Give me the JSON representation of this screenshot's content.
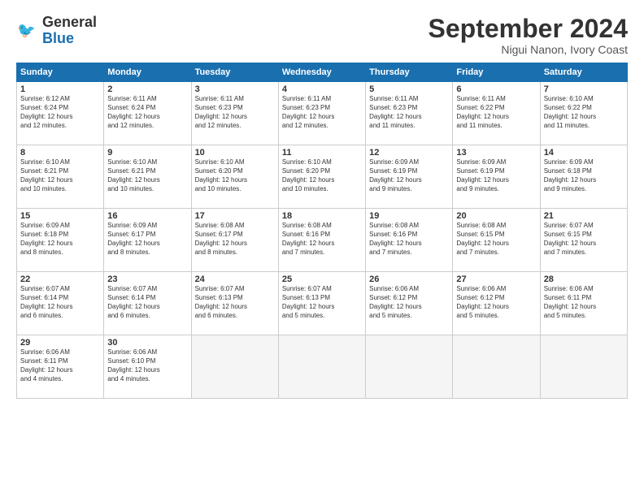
{
  "logo": {
    "line1": "General",
    "line2": "Blue"
  },
  "title": "September 2024",
  "subtitle": "Nigui Nanon, Ivory Coast",
  "weekdays": [
    "Sunday",
    "Monday",
    "Tuesday",
    "Wednesday",
    "Thursday",
    "Friday",
    "Saturday"
  ],
  "weeks": [
    [
      {
        "day": "1",
        "info": "Sunrise: 6:12 AM\nSunset: 6:24 PM\nDaylight: 12 hours\nand 12 minutes."
      },
      {
        "day": "2",
        "info": "Sunrise: 6:11 AM\nSunset: 6:24 PM\nDaylight: 12 hours\nand 12 minutes."
      },
      {
        "day": "3",
        "info": "Sunrise: 6:11 AM\nSunset: 6:23 PM\nDaylight: 12 hours\nand 12 minutes."
      },
      {
        "day": "4",
        "info": "Sunrise: 6:11 AM\nSunset: 6:23 PM\nDaylight: 12 hours\nand 12 minutes."
      },
      {
        "day": "5",
        "info": "Sunrise: 6:11 AM\nSunset: 6:23 PM\nDaylight: 12 hours\nand 11 minutes."
      },
      {
        "day": "6",
        "info": "Sunrise: 6:11 AM\nSunset: 6:22 PM\nDaylight: 12 hours\nand 11 minutes."
      },
      {
        "day": "7",
        "info": "Sunrise: 6:10 AM\nSunset: 6:22 PM\nDaylight: 12 hours\nand 11 minutes."
      }
    ],
    [
      {
        "day": "8",
        "info": "Sunrise: 6:10 AM\nSunset: 6:21 PM\nDaylight: 12 hours\nand 10 minutes."
      },
      {
        "day": "9",
        "info": "Sunrise: 6:10 AM\nSunset: 6:21 PM\nDaylight: 12 hours\nand 10 minutes."
      },
      {
        "day": "10",
        "info": "Sunrise: 6:10 AM\nSunset: 6:20 PM\nDaylight: 12 hours\nand 10 minutes."
      },
      {
        "day": "11",
        "info": "Sunrise: 6:10 AM\nSunset: 6:20 PM\nDaylight: 12 hours\nand 10 minutes."
      },
      {
        "day": "12",
        "info": "Sunrise: 6:09 AM\nSunset: 6:19 PM\nDaylight: 12 hours\nand 9 minutes."
      },
      {
        "day": "13",
        "info": "Sunrise: 6:09 AM\nSunset: 6:19 PM\nDaylight: 12 hours\nand 9 minutes."
      },
      {
        "day": "14",
        "info": "Sunrise: 6:09 AM\nSunset: 6:18 PM\nDaylight: 12 hours\nand 9 minutes."
      }
    ],
    [
      {
        "day": "15",
        "info": "Sunrise: 6:09 AM\nSunset: 6:18 PM\nDaylight: 12 hours\nand 8 minutes."
      },
      {
        "day": "16",
        "info": "Sunrise: 6:09 AM\nSunset: 6:17 PM\nDaylight: 12 hours\nand 8 minutes."
      },
      {
        "day": "17",
        "info": "Sunrise: 6:08 AM\nSunset: 6:17 PM\nDaylight: 12 hours\nand 8 minutes."
      },
      {
        "day": "18",
        "info": "Sunrise: 6:08 AM\nSunset: 6:16 PM\nDaylight: 12 hours\nand 7 minutes."
      },
      {
        "day": "19",
        "info": "Sunrise: 6:08 AM\nSunset: 6:16 PM\nDaylight: 12 hours\nand 7 minutes."
      },
      {
        "day": "20",
        "info": "Sunrise: 6:08 AM\nSunset: 6:15 PM\nDaylight: 12 hours\nand 7 minutes."
      },
      {
        "day": "21",
        "info": "Sunrise: 6:07 AM\nSunset: 6:15 PM\nDaylight: 12 hours\nand 7 minutes."
      }
    ],
    [
      {
        "day": "22",
        "info": "Sunrise: 6:07 AM\nSunset: 6:14 PM\nDaylight: 12 hours\nand 6 minutes."
      },
      {
        "day": "23",
        "info": "Sunrise: 6:07 AM\nSunset: 6:14 PM\nDaylight: 12 hours\nand 6 minutes."
      },
      {
        "day": "24",
        "info": "Sunrise: 6:07 AM\nSunset: 6:13 PM\nDaylight: 12 hours\nand 6 minutes."
      },
      {
        "day": "25",
        "info": "Sunrise: 6:07 AM\nSunset: 6:13 PM\nDaylight: 12 hours\nand 5 minutes."
      },
      {
        "day": "26",
        "info": "Sunrise: 6:06 AM\nSunset: 6:12 PM\nDaylight: 12 hours\nand 5 minutes."
      },
      {
        "day": "27",
        "info": "Sunrise: 6:06 AM\nSunset: 6:12 PM\nDaylight: 12 hours\nand 5 minutes."
      },
      {
        "day": "28",
        "info": "Sunrise: 6:06 AM\nSunset: 6:11 PM\nDaylight: 12 hours\nand 5 minutes."
      }
    ],
    [
      {
        "day": "29",
        "info": "Sunrise: 6:06 AM\nSunset: 6:11 PM\nDaylight: 12 hours\nand 4 minutes."
      },
      {
        "day": "30",
        "info": "Sunrise: 6:06 AM\nSunset: 6:10 PM\nDaylight: 12 hours\nand 4 minutes."
      },
      {
        "day": "",
        "info": ""
      },
      {
        "day": "",
        "info": ""
      },
      {
        "day": "",
        "info": ""
      },
      {
        "day": "",
        "info": ""
      },
      {
        "day": "",
        "info": ""
      }
    ]
  ]
}
